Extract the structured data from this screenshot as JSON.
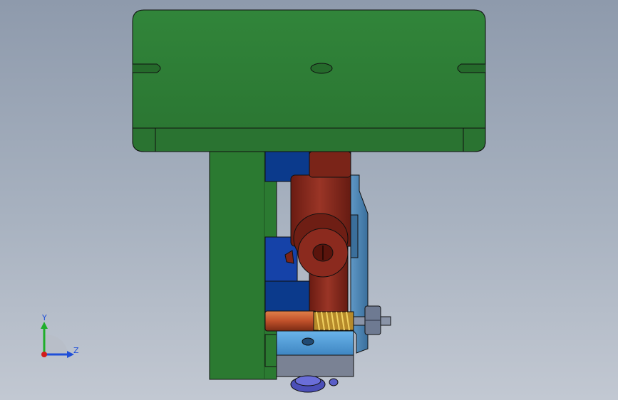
{
  "viewport": {
    "background_top": "#8e9aac",
    "background_bottom": "#c2c8d2"
  },
  "model": {
    "colors": {
      "green_plate": "#2e7a33",
      "green_dark": "#1f5a24",
      "navy_block": "#0b3a8c",
      "blue_block": "#123e9e",
      "maroon": "#8b2a1e",
      "maroon_dark": "#5e170f",
      "light_blue": "#5aa0d8",
      "steel_blue": "#4a86b8",
      "orange_rod": "#c0502a",
      "spring": "#c9a030",
      "nut": "#6e7a92",
      "purple_screw": "#4b4fb8",
      "outline": "#101010"
    }
  },
  "triad": {
    "y_label": "Y",
    "z_label": "Z",
    "y_color": "#1fae2a",
    "z_color": "#1f4fd8",
    "x_color": "#d21b1b"
  }
}
